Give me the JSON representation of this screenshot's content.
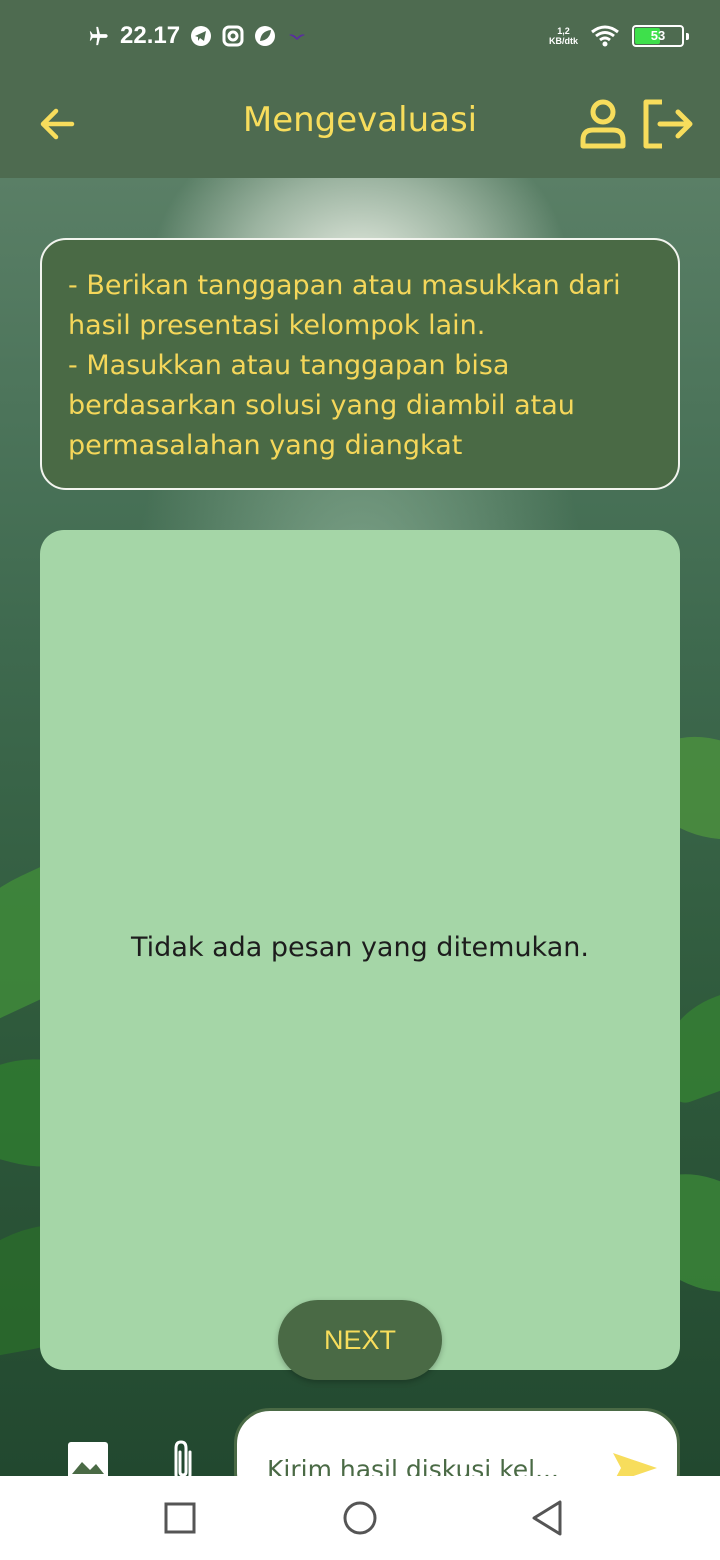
{
  "status_bar": {
    "time": "22.17",
    "speed_value": "1,2",
    "speed_unit": "KB/dtk",
    "battery_level": "53",
    "battery_fraction": 0.53,
    "icons": [
      "airplane-icon",
      "telegram-icon",
      "instagram-icon",
      "leaf-app-icon",
      "bat-icon",
      "wifi-icon",
      "battery-icon"
    ]
  },
  "app_bar": {
    "title": "Mengevaluasi",
    "icons": [
      "back-arrow-icon",
      "profile-icon",
      "logout-icon"
    ]
  },
  "instructions": {
    "line1": "- Berikan tanggapan atau masukkan dari hasil presentasi kelompok lain.",
    "line2": "- Masukkan atau tanggapan bisa berdasarkan solusi yang diambil atau permasalahan yang diangkat"
  },
  "chat": {
    "empty_text": "Tidak ada pesan yang ditemukan."
  },
  "next_button": {
    "label": "NEXT"
  },
  "composer": {
    "placeholder": "Kirim hasil diskusi kel...",
    "icons": [
      "image-icon",
      "attachment-icon",
      "send-icon"
    ]
  },
  "nav_bar": {
    "icons": [
      "recent-apps-icon",
      "home-icon",
      "back-icon"
    ]
  },
  "colors": {
    "app_bar": "#4e6b50",
    "accent_yellow": "#f7dd5c",
    "panel_green": "#4a6a45",
    "chat_bg": "#a5d6a7"
  }
}
